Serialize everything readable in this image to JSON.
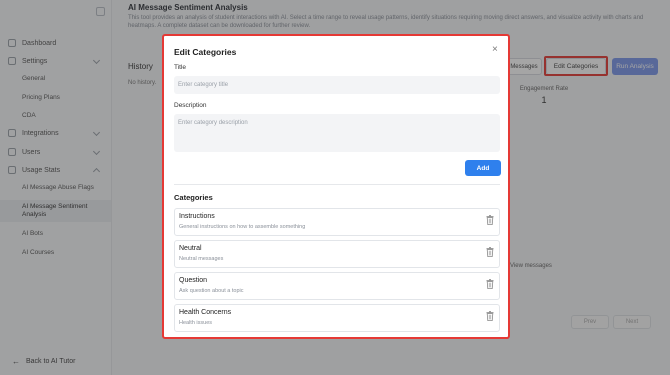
{
  "sidebar": {
    "items": [
      {
        "label": "Dashboard",
        "icon": "grid-icon"
      },
      {
        "label": "Settings",
        "icon": "gear-icon"
      },
      {
        "label": "Integrations",
        "icon": "plug-icon"
      },
      {
        "label": "Users",
        "icon": "users-icon"
      },
      {
        "label": "Usage Stats",
        "icon": "chart-icon"
      }
    ],
    "settings_sub": [
      "General",
      "Pricing Plans",
      "CDA"
    ],
    "usage_sub": [
      "AI Message Abuse Flags",
      "AI Message Sentiment Analysis",
      "AI Bots",
      "AI Courses"
    ],
    "back_label": "Back to AI Tutor"
  },
  "main": {
    "title": "AI Message Sentiment Analysis",
    "description": "This tool provides an analysis of student interactions with AI. Select a time range to reveal usage patterns, identify situations requiring moving direct answers, and visualize activity with charts and heatmaps. A complete dataset can be downloaded for further review.",
    "history_title": "History",
    "history_empty": "No history.",
    "messages_label": "Messages",
    "edit_categories_label": "Edit Categories",
    "run_analysis_label": "Run Analysis",
    "stat_label": "Engagement Rate",
    "stat_value": "1",
    "view_messages_label": "View messages",
    "prev_label": "Prev",
    "next_label": "Next"
  },
  "modal": {
    "title": "Edit Categories",
    "close_glyph": "×",
    "title_label": "Title",
    "title_placeholder": "Enter category title",
    "description_label": "Description",
    "description_placeholder": "Enter category description",
    "add_label": "Add",
    "categories_heading": "Categories",
    "categories": [
      {
        "name": "Instructions",
        "description": "General instructions on how to assemble something"
      },
      {
        "name": "Neutral",
        "description": "Neutral messages"
      },
      {
        "name": "Question",
        "description": "Ask question about a topic"
      },
      {
        "name": "Health Concerns",
        "description": "Health issues"
      }
    ]
  },
  "colors": {
    "accent": "#2f80ed",
    "highlight": "#e53935",
    "run_button": "#7b97ea"
  }
}
